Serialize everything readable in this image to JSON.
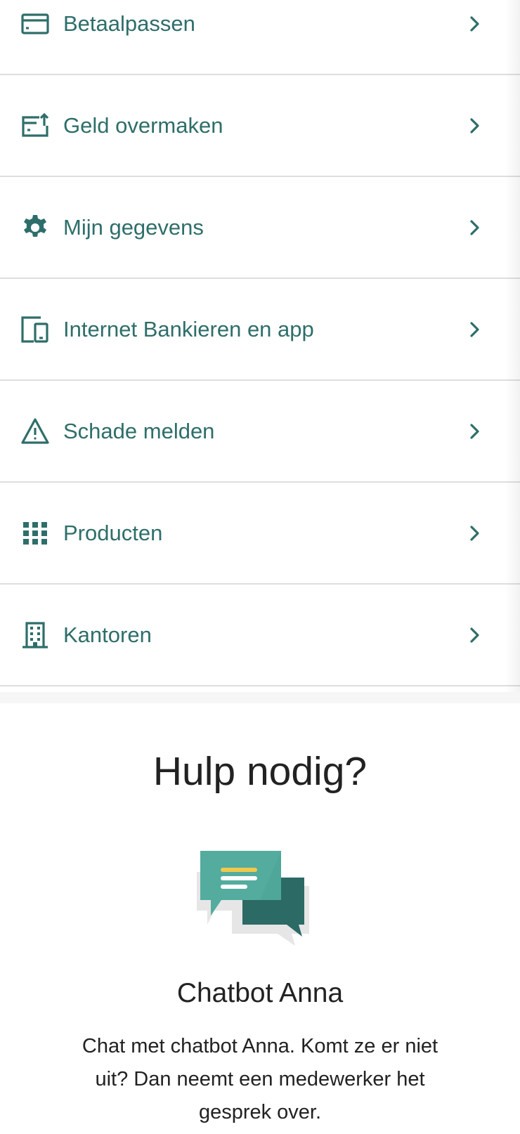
{
  "menu": {
    "items": [
      {
        "label": "Betaalpassen",
        "icon": "credit-card-icon"
      },
      {
        "label": "Geld overmaken",
        "icon": "transfer-icon"
      },
      {
        "label": "Mijn gegevens",
        "icon": "gear-icon"
      },
      {
        "label": "Internet Bankieren en app",
        "icon": "devices-icon"
      },
      {
        "label": "Schade melden",
        "icon": "warning-icon"
      },
      {
        "label": "Producten",
        "icon": "grid-icon"
      },
      {
        "label": "Kantoren",
        "icon": "building-icon"
      }
    ]
  },
  "help": {
    "title": "Hulp nodig?",
    "chat_title": "Chatbot Anna",
    "chat_description": "Chat met chatbot Anna. Komt ze er niet uit? Dan neemt een medewerker het gesprek over."
  },
  "colors": {
    "accent": "#2e6e6a",
    "chat_light": "#4fa79a",
    "chat_dark": "#2b6a65",
    "chat_highlight": "#f2c94c",
    "text": "#222222",
    "divider": "#dedede"
  }
}
